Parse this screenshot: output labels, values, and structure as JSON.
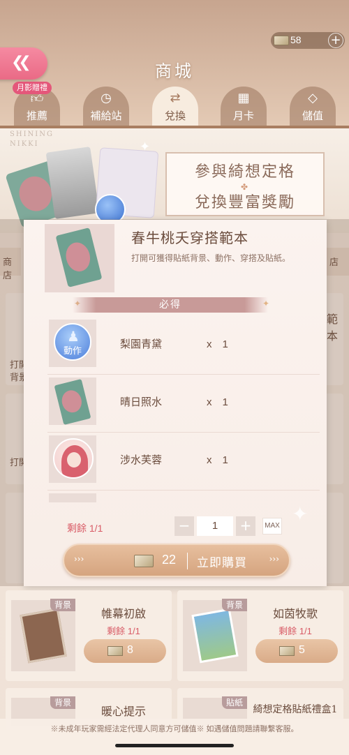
{
  "header": {
    "title": "商城",
    "currency_amount": "58",
    "gift_badge": "月影贈禮"
  },
  "tabs": [
    {
      "label": "推薦",
      "icon": "thumbs-up-icon"
    },
    {
      "label": "補給站",
      "icon": "clock-icon"
    },
    {
      "label": "兌換",
      "icon": "exchange-icon"
    },
    {
      "label": "月卡",
      "icon": "calendar-icon"
    },
    {
      "label": "儲值",
      "icon": "diamond-icon"
    }
  ],
  "banner": {
    "brand_line1": "SHINING",
    "brand_line2": "NIKKI",
    "promo_line1": "參與綺想定格",
    "promo_line2": "兌換豐富獎勵"
  },
  "side_tabs": {
    "left": "商店",
    "right": "店"
  },
  "modal": {
    "title": "春牛桃夭穿搭範本",
    "description": "打開可獲得貼紙背景、動作、穿搭及貼紙。",
    "section_label": "必得",
    "items": [
      {
        "name": "梨園青黛",
        "qty": "x　1",
        "icon_label": "動作"
      },
      {
        "name": "晴日照水",
        "qty": "x　1"
      },
      {
        "name": "涉水芙蓉",
        "qty": "x　1"
      }
    ],
    "remaining": "剩餘 1/1",
    "quantity": "1",
    "max_label": "MAX",
    "price": "22",
    "buy_label": "立即購買"
  },
  "shop_cards": [
    {
      "tag": "背景",
      "name": "帷幕初啟",
      "remaining": "剩餘 1/1",
      "price": "8"
    },
    {
      "tag": "背景",
      "name": "如茵牧歌",
      "remaining": "剩餘 1/1",
      "price": "5"
    },
    {
      "tag": "背景",
      "name": "暖心提示"
    },
    {
      "tag": "貼紙",
      "name": "綺想定格貼紙禮盒1"
    }
  ],
  "background_cards": {
    "fragment_right": "範本",
    "fragment_left": "打開",
    "fragment_left2": "背景"
  },
  "footer": {
    "notice": "※未成年玩家需經法定代理人同意方可儲值※ 如遇儲值問題請聯繫客服。"
  }
}
